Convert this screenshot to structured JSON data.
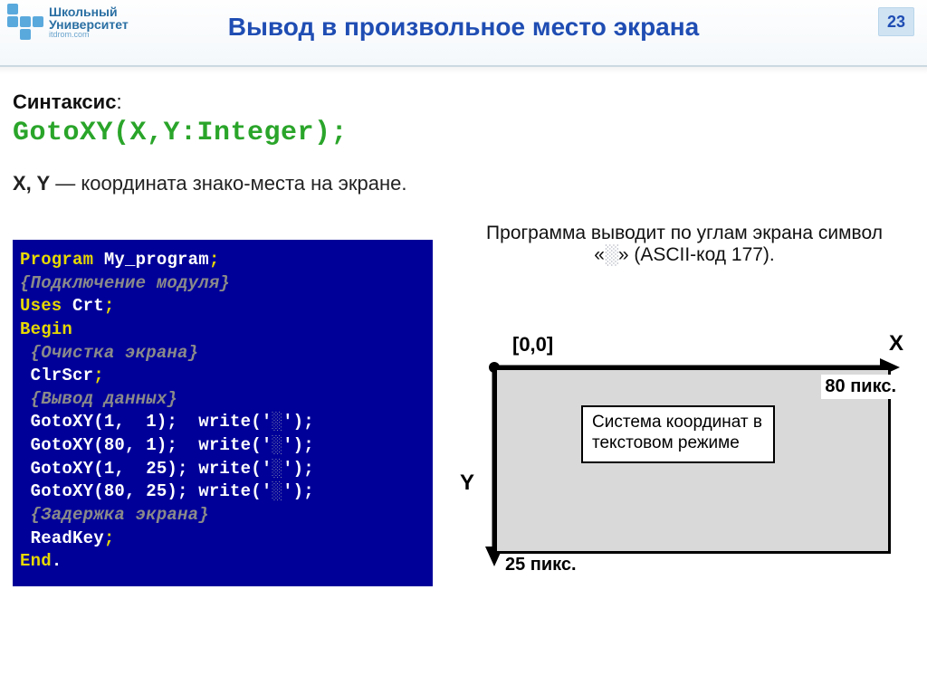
{
  "header": {
    "logo_line1": "Школьный",
    "logo_line2": "Университет",
    "logo_line3": "itdrom.com",
    "title": "Вывод в произвольное место экрана",
    "page_number": "23"
  },
  "syntax": {
    "label_bold": "Синтаксис",
    "label_suffix": ":",
    "code": "GotoXY(X,Y:Integer);"
  },
  "desc": {
    "bold": "X, Y",
    "rest": " — координата знако-места на экране."
  },
  "code": {
    "l1_kw": "Program ",
    "l1_id": "My_program",
    "l1_sc": ";",
    "l2_cmt": "{Подключение модуля}",
    "l3_kw": "Uses ",
    "l3_id": "Crt",
    "l3_sc": ";",
    "l4_kw": "Begin",
    "l5_cmt": " {Очистка экрана}",
    "l6_id": " ClrScr",
    "l6_sc": ";",
    "l7_cmt": " {Вывод данных}",
    "goto_a": " GotoXY(1,  1);  write('",
    "goto_b": "░",
    "goto_c": "');",
    "g2_a": " GotoXY(80, 1);  write('",
    "g3_a": " GotoXY(1,  25); write('",
    "g4_a": " GotoXY(80, 25); write('",
    "l12_cmt": " {Задержка экрана}",
    "l13_id": " ReadKey",
    "l13_sc": ";",
    "l14_kw": "End",
    "l14_dot": "."
  },
  "caption": {
    "pre": "Программа выводит по углам экрана символ «",
    "shade": "░",
    "post": "» (ASCII-код 177)."
  },
  "diagram": {
    "origin": "[0,0]",
    "x": "X",
    "y": "Y",
    "px80": "80 пикс.",
    "px25": "25 пикс.",
    "note": "Система координат в текстовом режиме"
  }
}
